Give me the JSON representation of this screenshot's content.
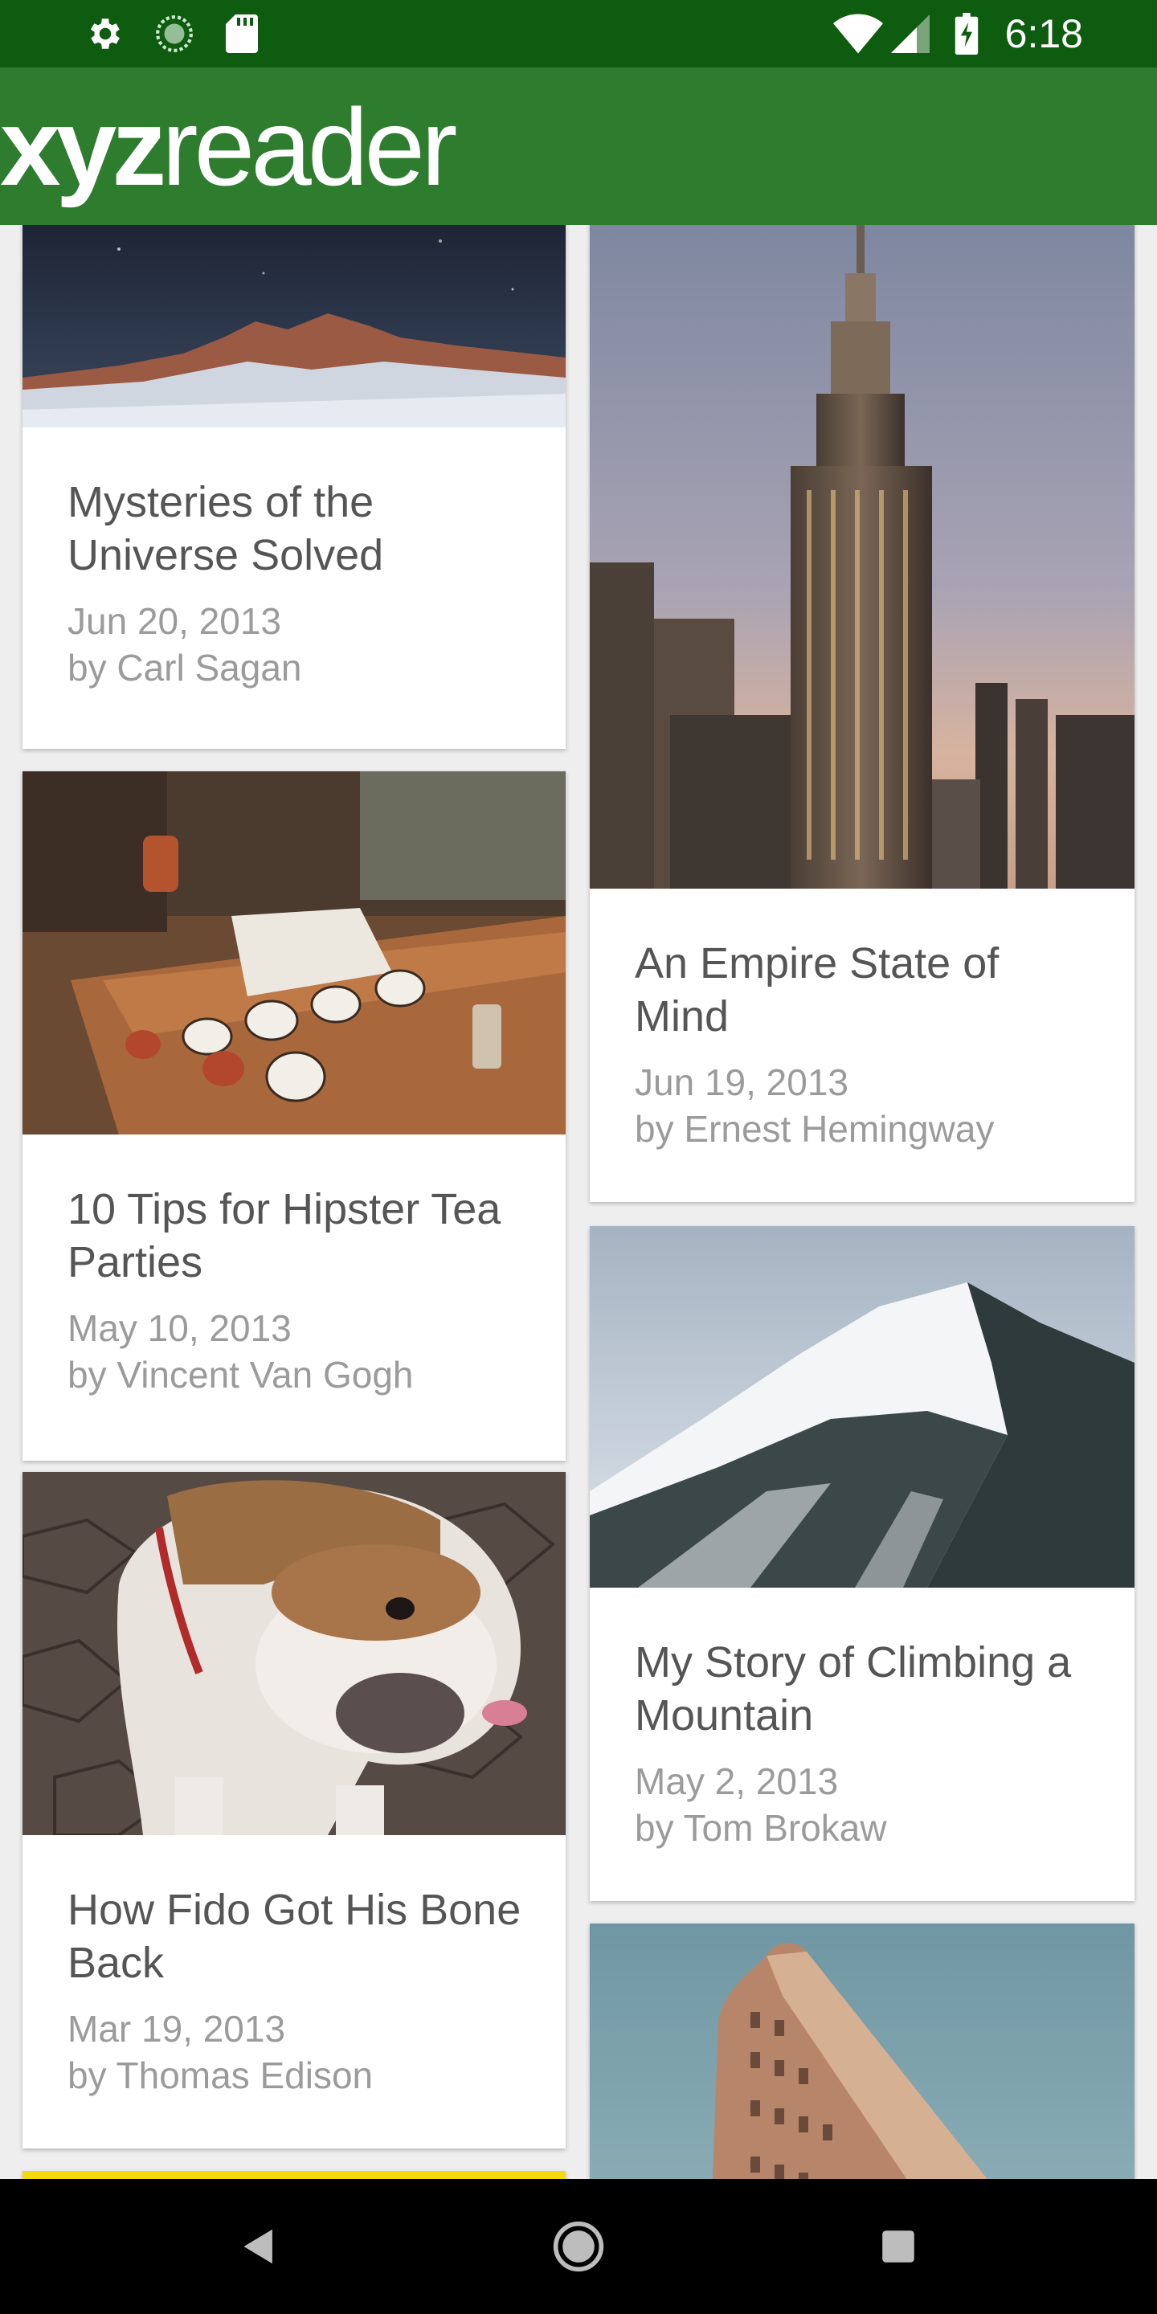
{
  "status_bar": {
    "time": "6:18",
    "left_icons": [
      "gear-icon",
      "sync-icon",
      "sd-card-icon"
    ],
    "right_icons": [
      "wifi-icon",
      "cellular-signal-icon",
      "battery-charging-icon"
    ],
    "background": "#0d5c0f"
  },
  "app_bar": {
    "logo_bold": "xyz",
    "logo_regular": "reader",
    "background": "#2e7d2e"
  },
  "articles": [
    {
      "title": "Mysteries of the Universe Solved",
      "date": "Jun 20, 2013",
      "author": "by Carl Sagan",
      "image": "starry-mountain-night"
    },
    {
      "title": "An Empire State of Mind",
      "date": "Jun 19, 2013",
      "author": "by Ernest Hemingway",
      "image": "empire-state-building"
    },
    {
      "title": "10 Tips for Hipster Tea Parties",
      "date": "May 10, 2013",
      "author": "by Vincent Van Gogh",
      "image": "tea-cups-table"
    },
    {
      "title": "My Story of Climbing a Mountain",
      "date": "May 2, 2013",
      "author": "by Tom Brokaw",
      "image": "snowy-mountain"
    },
    {
      "title": "How Fido Got His Bone Back",
      "date": "Mar 19, 2013",
      "author": "by Thomas Edison",
      "image": "bulldog"
    },
    {
      "title": "",
      "date": "",
      "author": "",
      "image": "yellow-banner"
    },
    {
      "title": "",
      "date": "",
      "author": "",
      "image": "flatiron-building"
    }
  ],
  "nav_bar": {
    "buttons": [
      "back-icon",
      "home-icon",
      "recents-icon"
    ],
    "background": "#000000"
  }
}
